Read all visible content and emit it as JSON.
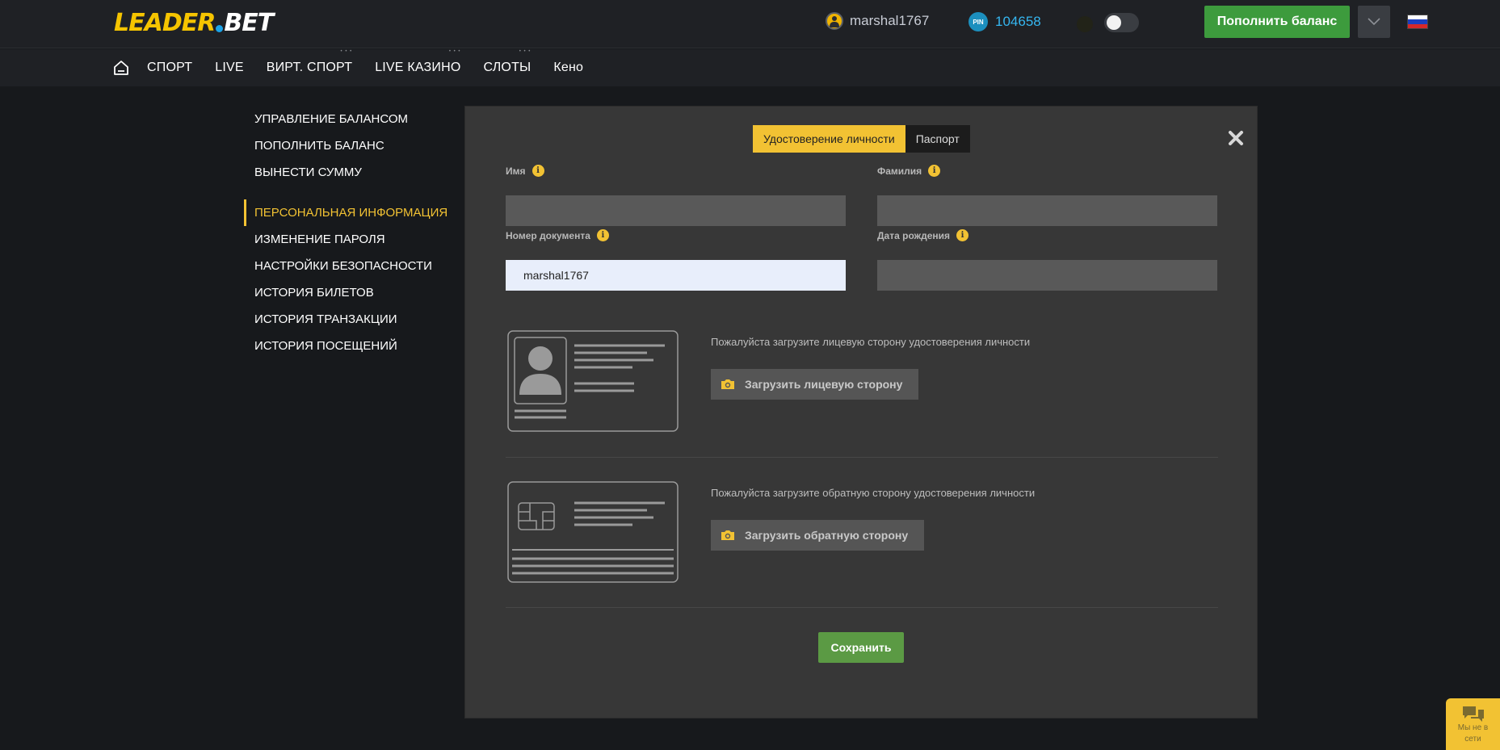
{
  "header": {
    "logo_left": "LEADER",
    "logo_right": "BET",
    "username": "marshal1767",
    "pin_label": "PIN",
    "pin_value": "104658",
    "deposit_label": "Пополнить баланс"
  },
  "nav": {
    "items": [
      "СПОРТ",
      "LIVE",
      "ВИРТ. СПОРТ",
      "LIVE КАЗИНО",
      "СЛОТЫ",
      "Кено"
    ]
  },
  "sidebar": {
    "group1": [
      "УПРАВЛЕНИЕ БАЛАНСОМ",
      "ПОПОЛНИТЬ БАЛАНС",
      "ВЫНЕСТИ СУММУ"
    ],
    "active": "ПЕРСОНАЛЬНАЯ ИНФОРМАЦИЯ",
    "group2": [
      "ИЗМЕНЕНИЕ ПАРОЛЯ",
      "НАСТРОЙКИ БЕЗОПАСНОСТИ",
      "ИСТОРИЯ БИЛЕТОВ",
      "ИСТОРИЯ ТРАНЗАКЦИИ",
      "ИСТОРИЯ ПОСЕЩЕНИЙ"
    ]
  },
  "form": {
    "tabs": [
      "Удостоверение личности",
      "Паспорт"
    ],
    "first_name_label": "Имя",
    "first_name_value": "",
    "last_name_label": "Фамилия",
    "last_name_value": "",
    "doc_number_label": "Номер документа",
    "doc_number_value": "marshal1767",
    "birth_date_label": "Дата рождения",
    "birth_date_value": "",
    "front_text": "Пожалуйста загрузите лицевую сторону удостоверения личности",
    "front_button": "Загрузить лицевую сторону",
    "back_text": "Пожалуйста загрузите обратную сторону удостоверения личности",
    "back_button": "Загрузить обратную сторону",
    "save_label": "Сохранить"
  },
  "chat": {
    "label": "Мы не в сети"
  },
  "colors": {
    "accent": "#f2c233",
    "deposit": "#3d9b3d",
    "save": "#5b9a44",
    "pin": "#35b6f0"
  }
}
